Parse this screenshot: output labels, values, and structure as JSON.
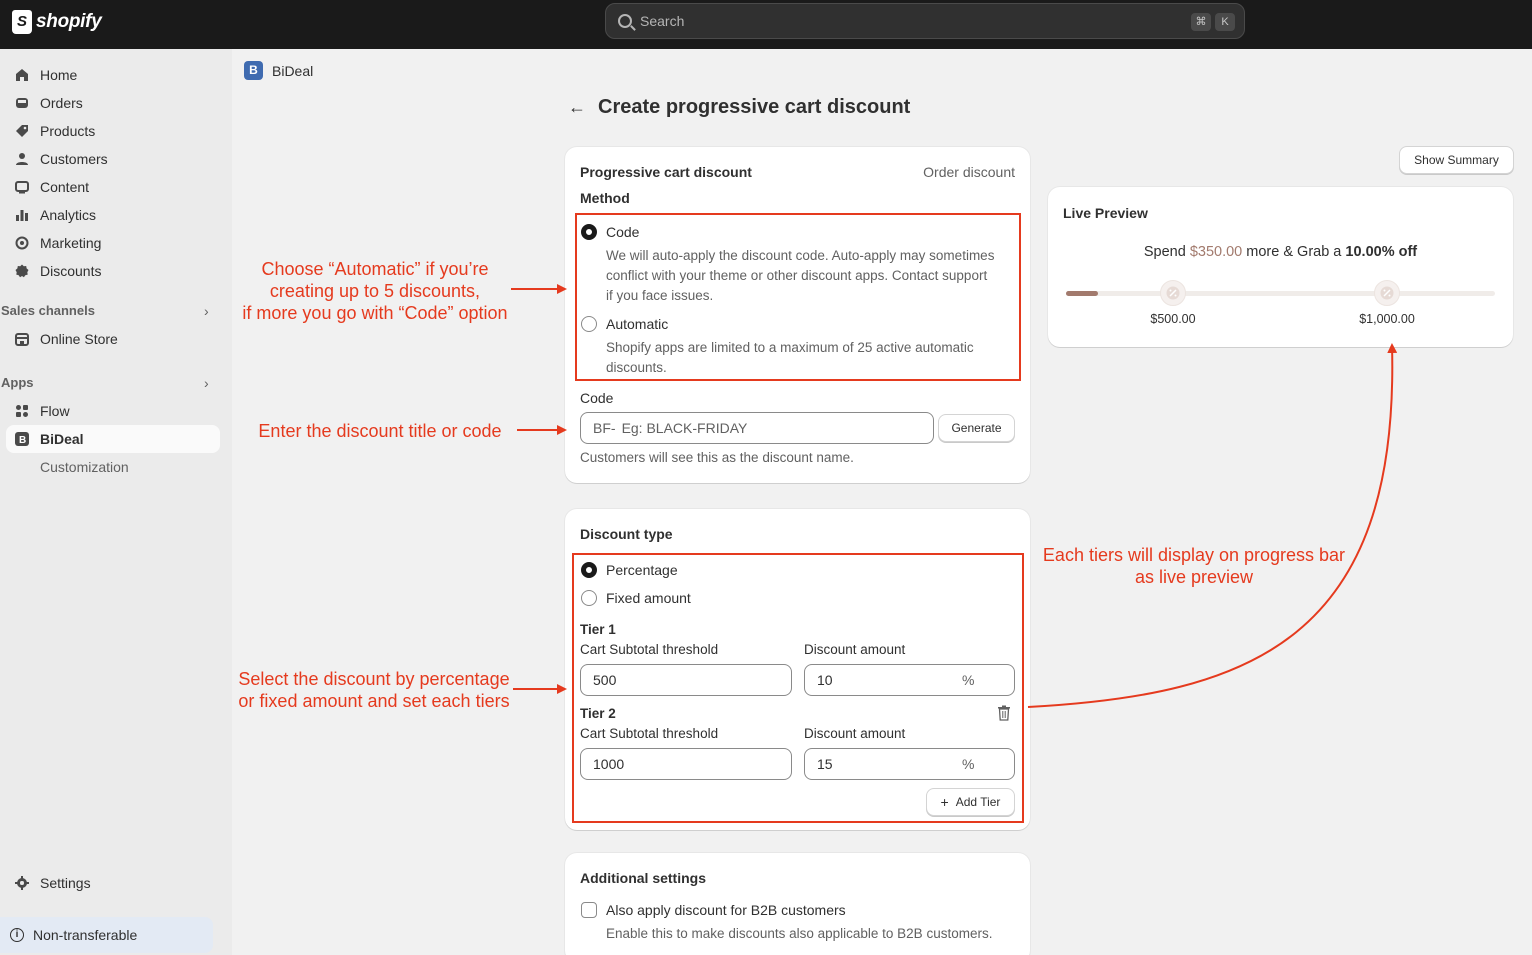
{
  "topbar": {
    "logo_text": "shopify",
    "search_placeholder": "Search",
    "shortcut_cmd": "⌘",
    "shortcut_key": "K"
  },
  "sidebar": {
    "items": [
      {
        "label": "Home",
        "icon": "home-icon"
      },
      {
        "label": "Orders",
        "icon": "orders-icon"
      },
      {
        "label": "Products",
        "icon": "tag-icon"
      },
      {
        "label": "Customers",
        "icon": "person-icon"
      },
      {
        "label": "Content",
        "icon": "content-icon"
      },
      {
        "label": "Analytics",
        "icon": "bar-chart-icon"
      },
      {
        "label": "Marketing",
        "icon": "target-icon"
      },
      {
        "label": "Discounts",
        "icon": "discount-icon"
      }
    ],
    "sales_channels_label": "Sales channels",
    "online_store_label": "Online Store",
    "apps_label": "Apps",
    "flow_label": "Flow",
    "bideal_label": "BiDeal",
    "customization_label": "Customization",
    "settings_label": "Settings",
    "non_transferable_label": "Non-transferable"
  },
  "app": {
    "name": "BiDeal",
    "logo_letter": "B",
    "page_title": "Create progressive cart discount"
  },
  "method_card": {
    "title": "Progressive cart discount",
    "subtitle": "Order discount",
    "method_label": "Method",
    "code_option": "Code",
    "code_desc_1": "We will auto-apply the discount code. Auto-apply may sometimes",
    "code_desc_2": "conflict with your theme or other discount apps. Contact support",
    "code_desc_3": "if you face issues.",
    "automatic_option": "Automatic",
    "automatic_desc_1": "Shopify apps are limited to a maximum of 25 active automatic",
    "automatic_desc_2": "discounts.",
    "code_field_label": "Code",
    "code_prefix": "BF-",
    "code_placeholder": "Eg: BLACK-FRIDAY",
    "generate_button": "Generate",
    "code_help": "Customers will see this as the discount name."
  },
  "discount_type_card": {
    "title": "Discount type",
    "percentage_option": "Percentage",
    "fixed_option": "Fixed amount",
    "tiers": [
      {
        "label": "Tier 1",
        "threshold_label": "Cart Subtotal threshold",
        "threshold_value": "500",
        "amount_label": "Discount amount",
        "amount_value": "10",
        "unit": "%"
      },
      {
        "label": "Tier 2",
        "threshold_label": "Cart Subtotal threshold",
        "threshold_value": "1000",
        "amount_label": "Discount amount",
        "amount_value": "15",
        "unit": "%"
      }
    ],
    "add_tier_button": "Add Tier"
  },
  "additional_card": {
    "title": "Additional settings",
    "b2b_label": "Also apply discount for B2B customers",
    "b2b_help": "Enable this to make discounts also applicable to B2B customers."
  },
  "preview": {
    "show_summary_button": "Show Summary",
    "title": "Live Preview",
    "msg_pre": "Spend ",
    "msg_amount": "$350.00",
    "msg_mid": " more & Grab a ",
    "msg_discount": "10.00% off",
    "progress_fraction": 0.3,
    "tier_labels": [
      "$500.00",
      "$1,000.00"
    ],
    "accent_color": "#a27a6d"
  },
  "annotations": {
    "method_1": "Choose “Automatic” if you’re",
    "method_2": "creating up to 5 discounts,",
    "method_3": "if more you go with “Code” option",
    "code": "Enter the discount title or code",
    "type_1": "Select the discount by percentage",
    "type_2": "or fixed amount and set each tiers",
    "preview_1": "Each tiers will display on progress bar",
    "preview_2": "as live preview",
    "color": "#e53a1e"
  }
}
